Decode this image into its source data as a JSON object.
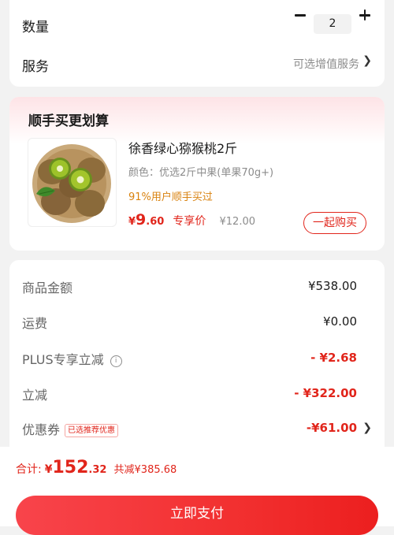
{
  "order": {
    "quantity_label": "数量",
    "quantity_value": "2",
    "service_label": "服务",
    "service_value": "可选增值服务",
    "chevron": "❯"
  },
  "bundle": {
    "title": "顺手买更划算",
    "product": {
      "name": "徐香绿心猕猴桃2斤",
      "spec": "颜色：优选2斤中果(单果70g+)",
      "social_proof": "91%用户顺手买过",
      "price_symbol": "¥",
      "price_int": "9",
      "price_dec": ".60",
      "price_tag": "专享价",
      "original_price": "¥12.00",
      "image_icon": "kiwi-fruit-image"
    },
    "buy_button": "一起购买"
  },
  "summary": {
    "rows": [
      {
        "label": "商品金额",
        "value": "¥538.00"
      },
      {
        "label": "运费",
        "value": "¥0.00"
      },
      {
        "label": "PLUS专享立减",
        "value": "- ¥2.68",
        "info_icon": "i"
      },
      {
        "label": "立减",
        "value": "- ¥322.00"
      },
      {
        "label": "优惠券",
        "value": "-¥61.00",
        "badge": "已选推荐优惠"
      }
    ],
    "chevron": "❯"
  },
  "footer": {
    "total_label": "合计:",
    "total_symbol": "¥",
    "total_int": "152",
    "total_dec": ".32",
    "saved_text": "共减¥385.68",
    "pay_button": "立即支付"
  },
  "colors": {
    "accent_red": "#e1251b",
    "promo_orange": "#d9820f",
    "muted_gray": "#8c8c8c",
    "background": "#f2f2f2"
  }
}
